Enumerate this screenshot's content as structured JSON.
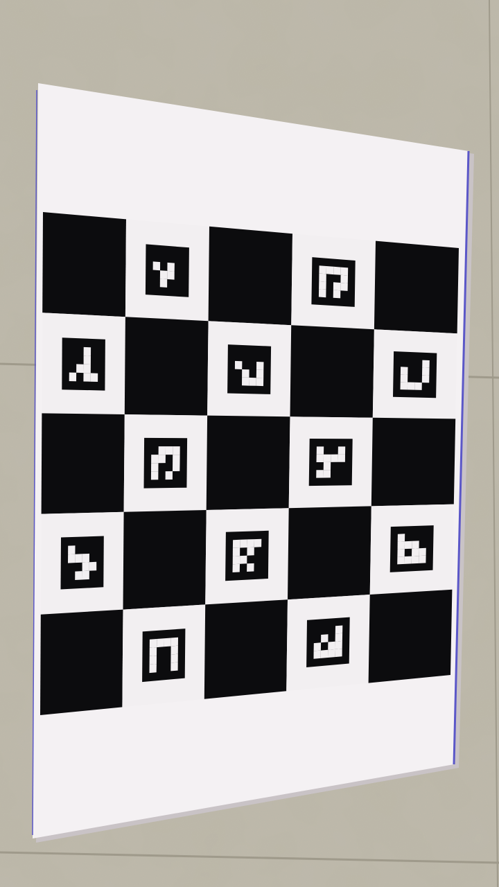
{
  "scene": {
    "description_tag": "photo",
    "colors": {
      "floor": "#bdb8a8",
      "floor_dark": "#aaa595",
      "grout": "#9f9a8b",
      "sheet": "#f4f1f3",
      "sheet_shadow": "#c9c3c6",
      "edge_tint": "#5b57c8",
      "black": "#0c0c0e",
      "white": "#f2eff1"
    },
    "board": {
      "rows": 5,
      "cols": 5,
      "marker_grid": 6,
      "markers": [
        {
          "row": 0,
          "col": 1,
          "bits": [
            "0000",
            "1010",
            "0110",
            "0100"
          ]
        },
        {
          "row": 0,
          "col": 3,
          "bits": [
            "1111",
            "1001",
            "1011",
            "1010"
          ]
        },
        {
          "row": 1,
          "col": 0,
          "bits": [
            "0010",
            "0010",
            "0110",
            "1011"
          ]
        },
        {
          "row": 1,
          "col": 2,
          "bits": [
            "0000",
            "1001",
            "0101",
            "0111"
          ]
        },
        {
          "row": 1,
          "col": 4,
          "bits": [
            "0001",
            "1001",
            "1001",
            "1110"
          ]
        },
        {
          "row": 2,
          "col": 1,
          "bits": [
            "0111",
            "1101",
            "1001",
            "1010"
          ]
        },
        {
          "row": 2,
          "col": 3,
          "bits": [
            "1001",
            "1111",
            "0100",
            "1100"
          ]
        },
        {
          "row": 3,
          "col": 0,
          "bits": [
            "1000",
            "1110",
            "0011",
            "0110"
          ]
        },
        {
          "row": 3,
          "col": 2,
          "bits": [
            "1111",
            "1010",
            "1100",
            "1010"
          ]
        },
        {
          "row": 3,
          "col": 4,
          "bits": [
            "1000",
            "1110",
            "1011",
            "1111"
          ]
        },
        {
          "row": 4,
          "col": 1,
          "bits": [
            "1111",
            "1001",
            "1001",
            "1001"
          ]
        },
        {
          "row": 4,
          "col": 3,
          "bits": [
            "0001",
            "0101",
            "1011",
            "1111"
          ]
        }
      ]
    }
  }
}
